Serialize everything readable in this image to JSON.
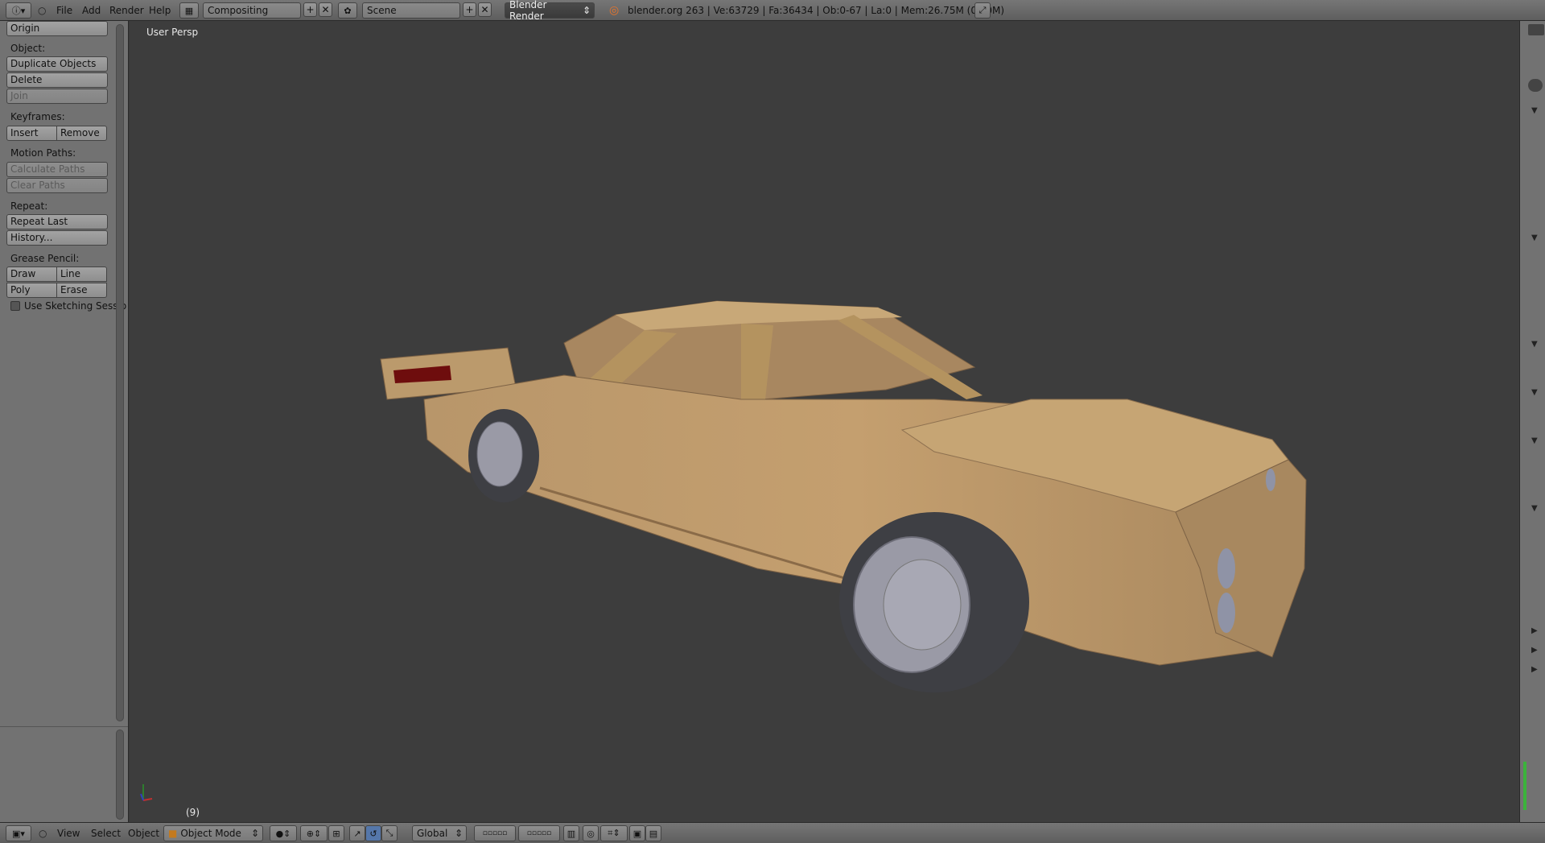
{
  "topbar": {
    "menus": [
      "File",
      "Add",
      "Render",
      "Help"
    ],
    "layout": "Compositing",
    "scene": "Scene",
    "engine": "Blender Render",
    "stats": "blender.org 263 | Ve:63729 | Fa:36434 | Ob:0-67 | La:0 | Mem:26.75M (0.10M)"
  },
  "left": {
    "origin": "Origin",
    "object_label": "Object:",
    "duplicate": "Duplicate Objects",
    "delete": "Delete",
    "join": "Join",
    "keyframes_label": "Keyframes:",
    "insert": "Insert",
    "remove": "Remove",
    "motion_label": "Motion Paths:",
    "calc_paths": "Calculate Paths",
    "clear_paths": "Clear Paths",
    "repeat_label": "Repeat:",
    "repeat_last": "Repeat Last",
    "history": "History...",
    "grease_label": "Grease Pencil:",
    "draw": "Draw",
    "line": "Line",
    "poly": "Poly",
    "erase": "Erase",
    "sketch": "Use Sketching Sessio"
  },
  "viewport": {
    "title": "User Persp",
    "frame": "(9)"
  },
  "bottombar": {
    "view": "View",
    "select": "Select",
    "object": "Object",
    "mode": "Object Mode",
    "orientation": "Global"
  },
  "colors": {
    "car_body": "#c29c6a",
    "tire": "#3e3f44",
    "hub": "#9a9aa6",
    "bg": "#3d3d3d"
  }
}
